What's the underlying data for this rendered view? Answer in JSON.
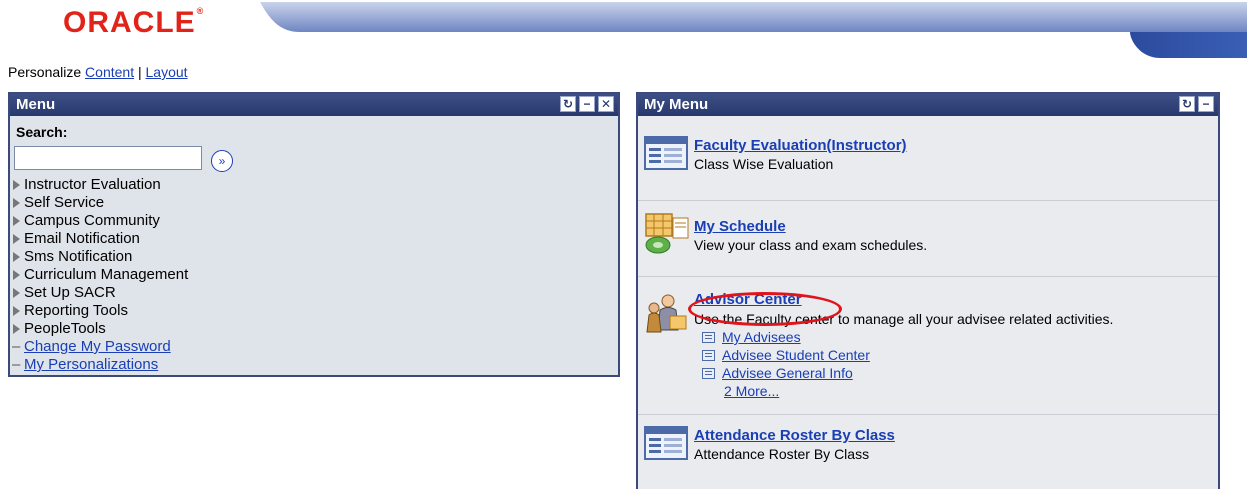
{
  "brand": {
    "logo_text": "ORACLE",
    "logo_mark": "®",
    "color": "#e2231a"
  },
  "personalize": {
    "label": "Personalize",
    "content_link": "Content",
    "separator": "|",
    "layout_link": "Layout"
  },
  "menu": {
    "title": "Menu",
    "search_label": "Search:",
    "search_value": "",
    "go_icon": "double-chevron-right-icon",
    "folders": [
      "Instructor Evaluation",
      "Self Service",
      "Campus Community",
      "Email Notification",
      "Sms Notification",
      "Curriculum Management",
      "Set Up SACR",
      "Reporting Tools",
      "PeopleTools"
    ],
    "links": [
      "Change My Password",
      "My Personalizations"
    ],
    "header_icons": [
      "refresh-icon",
      "minimize-icon",
      "close-icon"
    ]
  },
  "my_menu": {
    "title": "My Menu",
    "header_icons": [
      "refresh-icon",
      "minimize-icon"
    ],
    "items": [
      {
        "title": "Faculty Evaluation(Instructor)",
        "description": "Class Wise Evaluation",
        "icon": "component-page-icon"
      },
      {
        "title": "My Schedule",
        "description": "View your class and exam schedules.",
        "icon": "schedule-calendar-icon"
      },
      {
        "title": "Advisor Center",
        "description": "Use the Faculty center to manage all your advisee related activities.",
        "icon": "advisor-people-icon",
        "sub_links": [
          "My Advisees",
          "Advisee Student Center",
          "Advisee General Info"
        ],
        "more_link": "2 More..."
      },
      {
        "title": "Attendance Roster By Class",
        "description": "Attendance Roster By Class",
        "icon": "component-page-icon"
      }
    ]
  },
  "colors": {
    "header_bar": "#2e3f78",
    "link": "#1a3fb4",
    "highlight": "#e0141b"
  }
}
